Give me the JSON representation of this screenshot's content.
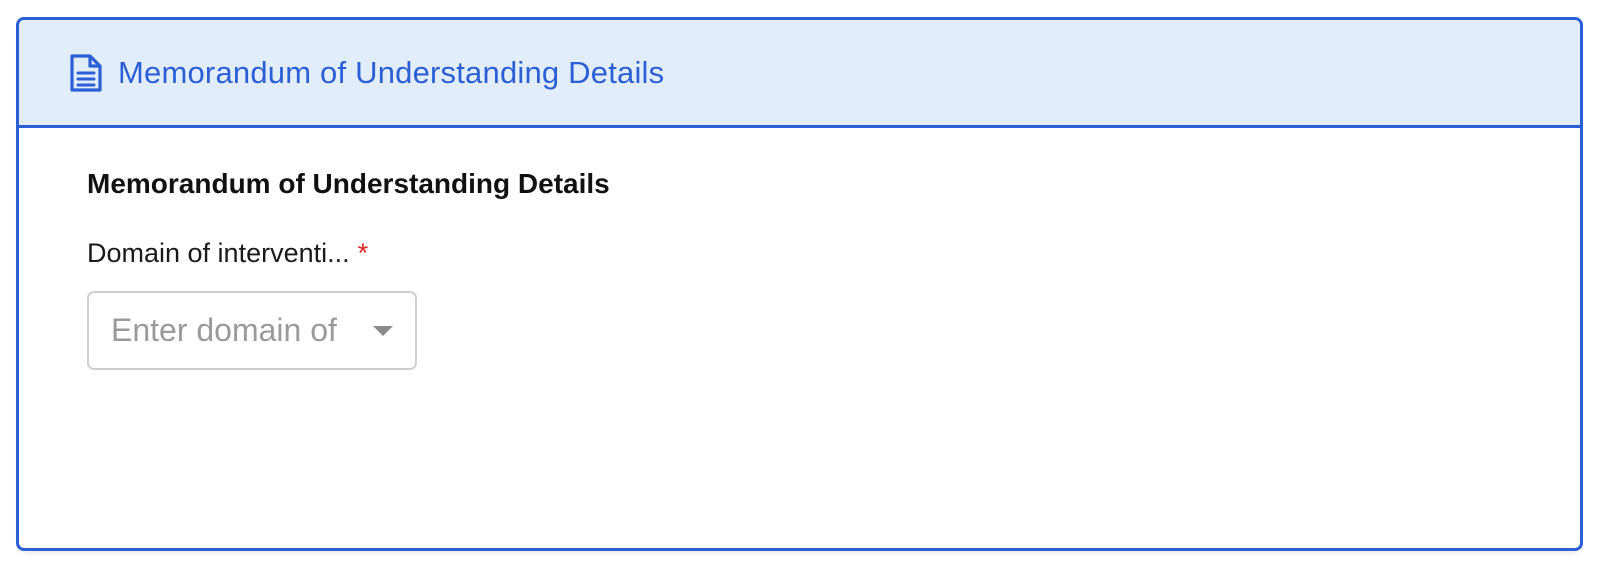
{
  "header": {
    "title": "Memorandum of Understanding Details",
    "icon": "document-icon",
    "accent_color": "#2c5fd6",
    "background_color": "#e1edfa"
  },
  "section": {
    "title": "Memorandum of Understanding Details"
  },
  "fields": [
    {
      "label": "Domain of interventi...",
      "required_marker": "*",
      "placeholder": "Enter domain of",
      "type": "select"
    }
  ]
}
